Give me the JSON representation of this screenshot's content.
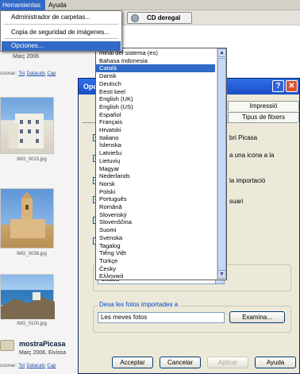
{
  "menubar": {
    "herramientas": "Herramientas",
    "ayuda": "Ayuda"
  },
  "toolbar": {
    "cd_button": "CD deregal"
  },
  "dropdown": {
    "items": [
      "Administrador de carpetas...",
      "Copia de seguridad de imágenes...",
      "Opciones..."
    ]
  },
  "library": {
    "folder1_date": "Març 2006",
    "selection_prefix": "ccionar:",
    "selection_links": [
      "Tot",
      "Datacats",
      "Cap"
    ],
    "thumbs": [
      "IMG_0015.jpg",
      "IMG_0038.jpg",
      "IMG_0100.jpg"
    ],
    "folder2_title": "mostraPicasa",
    "folder2_date": "Març 2006, Eivissa",
    "selection2_prefix": "ccionar:",
    "selection2_links": [
      "Tot",
      "Datacats",
      "Cap"
    ]
  },
  "language_list": {
    "items": [
      "minal del sistema (es)",
      "Bahasa Indonesia",
      "Català",
      "Dansk",
      "Deutsch",
      "Eesti keel",
      "English (UK)",
      "English (US)",
      "Español",
      "Français",
      "Hrvatski",
      "Italiano",
      "Íslenska",
      "Latviešu",
      "Lietuvių",
      "Magyar",
      "Nederlands",
      "Norsk",
      "Polski",
      "Português",
      "Română",
      "Slovenský",
      "Slovenščina",
      "Suomi",
      "Svenska",
      "Tagalog",
      "Tiếng Việt",
      "Türkçe",
      "Česky",
      "Ελληνικά"
    ],
    "selected": "Català"
  },
  "dialog": {
    "title": "Opci",
    "tabs": [
      "Impressió",
      "Tipus de fitxers"
    ],
    "options": [
      "bri Picasa",
      "a una icona a la",
      "la importació",
      "suari"
    ],
    "language_combo": "Català",
    "import_group_label": "Desa les fotos importades a",
    "import_path": "Les meves fotos",
    "browse_button": "Examina...",
    "buttons": {
      "accept": "Acceptar",
      "cancel": "Cancelar",
      "apply": "Aplicar",
      "help": "Ayuda"
    }
  },
  "colors": {
    "selection": "#316ac5",
    "titlebar": "#1b4fc7",
    "close": "#d9532f"
  }
}
